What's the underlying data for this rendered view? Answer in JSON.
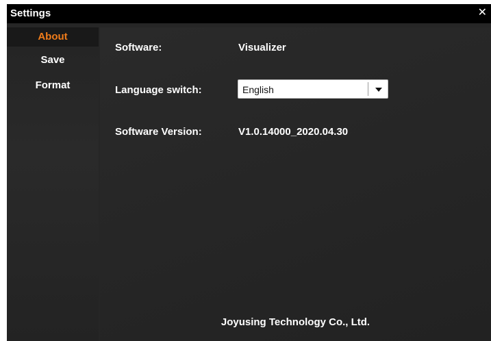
{
  "window": {
    "title": "Settings",
    "close_glyph": "✕"
  },
  "sidebar": {
    "items": [
      {
        "label": "About",
        "active": true
      },
      {
        "label": "Save",
        "active": false
      },
      {
        "label": "Format",
        "active": false
      }
    ]
  },
  "about": {
    "software_label": "Software:",
    "software_value": "Visualizer",
    "language_label": "Language switch:",
    "language_selected": "English",
    "version_label": "Software Version:",
    "version_value": "V1.0.14000_2020.04.30",
    "footer": "Joyusing Technology Co., Ltd."
  },
  "colors": {
    "accent": "#f07c1a",
    "background": "#262626",
    "titlebar": "#000000",
    "text": "#ffffff"
  },
  "icons": {
    "close": "close-icon",
    "dropdown": "chevron-down-icon"
  }
}
